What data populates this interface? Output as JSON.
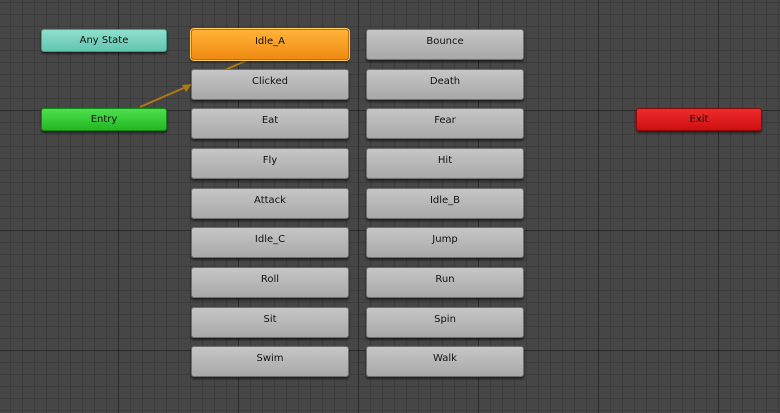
{
  "special_states": {
    "any_state": "Any State",
    "entry": "Entry",
    "exit": "Exit"
  },
  "states": {
    "column_1": [
      "Idle_A",
      "Clicked",
      "Eat",
      "Fly",
      "Attack",
      "Idle_C",
      "Roll",
      "Sit",
      "Swim"
    ],
    "column_2": [
      "Bounce",
      "Death",
      "Fear",
      "Hit",
      "Idle_B",
      "Jump",
      "Run",
      "Spin",
      "Walk"
    ]
  },
  "default_state": "Idle_A",
  "transitions": [
    {
      "from": "Entry",
      "to": "Idle_A"
    }
  ],
  "colors": {
    "default_state": "#f59b1c",
    "any_state": "#6fcfb9",
    "entry": "#2ecc2e",
    "exit": "#dd1b1b",
    "state": "#b8b8b8",
    "transition": "#b07a10"
  }
}
